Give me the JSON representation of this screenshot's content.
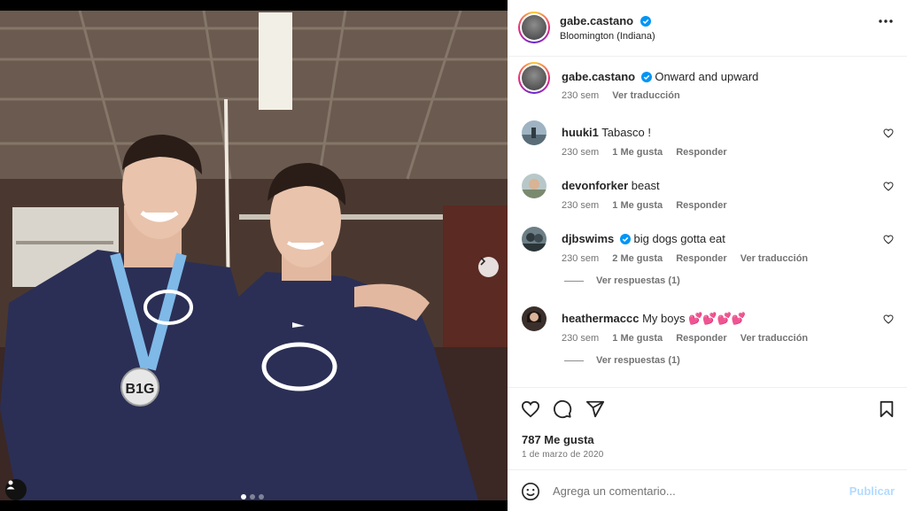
{
  "post": {
    "author": "gabe.castano",
    "location": "Bloomington (Indiana)",
    "caption": "Onward and upward",
    "caption_age": "230 sem",
    "caption_translate": "Ver traducción",
    "likes": "787 Me gusta",
    "date": "1 de marzo de 2020"
  },
  "media": {
    "slide_count": 3,
    "active_slide": 1
  },
  "comments": [
    {
      "user": "huuki1",
      "verified": false,
      "text": "Tabasco !",
      "age": "230 sem",
      "likes": "1 Me gusta",
      "reply": "Responder",
      "translate": "",
      "replies": ""
    },
    {
      "user": "devonforker",
      "verified": false,
      "text": "beast",
      "age": "230 sem",
      "likes": "1 Me gusta",
      "reply": "Responder",
      "translate": "",
      "replies": ""
    },
    {
      "user": "djbswims",
      "verified": true,
      "text": "big dogs gotta eat",
      "age": "230 sem",
      "likes": "2 Me gusta",
      "reply": "Responder",
      "translate": "Ver traducción",
      "replies": "Ver respuestas (1)"
    },
    {
      "user": "heathermaccc",
      "verified": false,
      "text": "My boys 💕💕💕💕",
      "age": "230 sem",
      "likes": "1 Me gusta",
      "reply": "Responder",
      "translate": "Ver traducción",
      "replies": "Ver respuestas (1)"
    }
  ],
  "composer": {
    "placeholder": "Agrega un comentario...",
    "publish": "Publicar"
  },
  "colors": {
    "verified": "#0095f6",
    "publish_disabled": "#b3dbff",
    "hoodie": "#2b2f55",
    "ribbon": "#7fb9e8"
  },
  "icons": [
    "more-options-icon",
    "heart-icon",
    "comment-icon",
    "share-icon",
    "save-icon",
    "emoji-icon",
    "verified-badge-icon",
    "next-slide-icon",
    "user-tag-icon"
  ]
}
